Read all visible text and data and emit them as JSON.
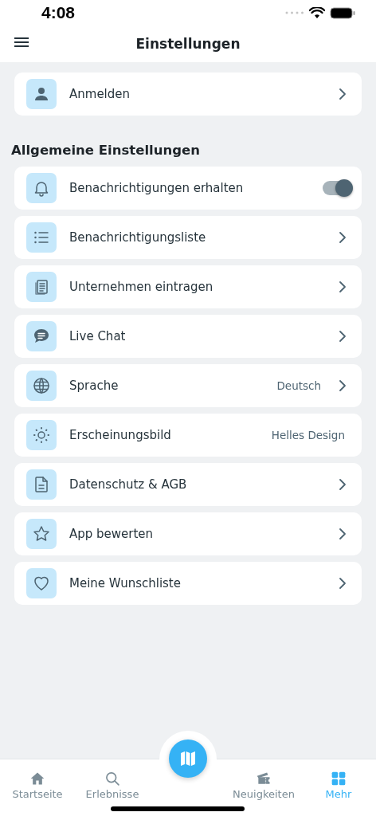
{
  "status_bar": {
    "time": "4:08"
  },
  "header": {
    "title": "Einstellungen"
  },
  "account": {
    "label": "Anmelden"
  },
  "section": {
    "title": "Allgemeine Einstellungen"
  },
  "settings": [
    {
      "kind": "toggle",
      "label": "Benachrichtigungen erhalten",
      "on": true
    },
    {
      "kind": "link",
      "label": "Benachrichtigungsliste"
    },
    {
      "kind": "link",
      "label": "Unternehmen eintragen"
    },
    {
      "kind": "link",
      "label": "Live Chat"
    },
    {
      "kind": "value-link",
      "label": "Sprache",
      "value": "Deutsch"
    },
    {
      "kind": "value",
      "label": "Erscheinungsbild",
      "value": "Helles Design"
    },
    {
      "kind": "link",
      "label": "Datenschutz & AGB"
    },
    {
      "kind": "link",
      "label": "App bewerten"
    },
    {
      "kind": "link",
      "label": "Meine Wunschliste"
    }
  ],
  "tab_bar": [
    {
      "label": "Startseite",
      "selected": false
    },
    {
      "label": "Erlebnisse",
      "selected": false
    },
    {
      "label": "Neuigkeiten",
      "selected": false
    },
    {
      "label": "Mehr",
      "selected": true
    }
  ]
}
